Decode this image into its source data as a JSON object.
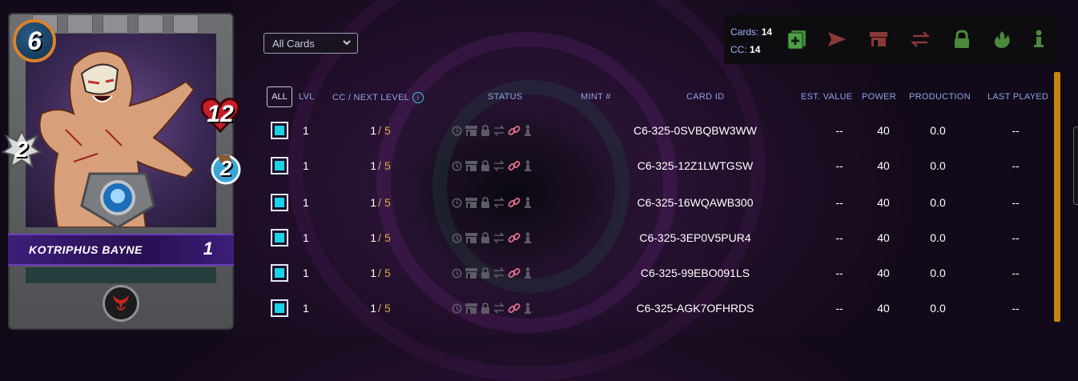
{
  "card": {
    "name": "KOTRIPHUS BAYNE",
    "level": "1",
    "mana": "6",
    "health": "12",
    "melee": "2",
    "speed": "2",
    "colors": {
      "banner": "#3c1e7a",
      "mana_ring": "#d9822b"
    },
    "icons": {
      "ability": "demon-horns-icon",
      "melee": "sawblade-icon",
      "speed": "boot-icon",
      "health": "heart-icon"
    }
  },
  "filter": {
    "selected": "All Cards"
  },
  "toolbar": {
    "cards_label": "Cards:",
    "cards_count": "14",
    "cc_label": "CC:",
    "cc_count": "14",
    "icons": [
      "add-card-icon",
      "send-icon",
      "market-icon",
      "transfer-icon",
      "lock-icon",
      "burn-icon",
      "delegate-icon"
    ]
  },
  "table": {
    "all_label": "ALL",
    "columns": {
      "lvl": "LVL",
      "cc_next": "CC / NEXT LEVEL",
      "status": "STATUS",
      "mint": "MINT #",
      "card_id": "CARD ID",
      "est_value": "EST. VALUE",
      "power": "POWER",
      "production": "PRODUCTION",
      "last_played": "LAST PLAYED"
    },
    "rows": [
      {
        "lvl": "1",
        "cc": "1",
        "next": "5",
        "card_id": "C6-325-0SVBQBW3WW",
        "est_value": "--",
        "power": "40",
        "production": "0.0",
        "last_played": "--"
      },
      {
        "lvl": "1",
        "cc": "1",
        "next": "5",
        "card_id": "C6-325-12Z1LWTGSW",
        "est_value": "--",
        "power": "40",
        "production": "0.0",
        "last_played": "--"
      },
      {
        "lvl": "1",
        "cc": "1",
        "next": "5",
        "card_id": "C6-325-16WQAWB300",
        "est_value": "--",
        "power": "40",
        "production": "0.0",
        "last_played": "--"
      },
      {
        "lvl": "1",
        "cc": "1",
        "next": "5",
        "card_id": "C6-325-3EP0V5PUR4",
        "est_value": "--",
        "power": "40",
        "production": "0.0",
        "last_played": "--"
      },
      {
        "lvl": "1",
        "cc": "1",
        "next": "5",
        "card_id": "C6-325-99EBO091LS",
        "est_value": "--",
        "power": "40",
        "production": "0.0",
        "last_played": "--"
      },
      {
        "lvl": "1",
        "cc": "1",
        "next": "5",
        "card_id": "C6-325-AGK7OFHRDS",
        "est_value": "--",
        "power": "40",
        "production": "0.0",
        "last_played": "--"
      }
    ],
    "status_icons": [
      "clock-icon",
      "market-icon",
      "lock-icon",
      "transfer-icon",
      "link-icon",
      "delegate-icon"
    ],
    "colors": {
      "checkbox": "#19d4e7",
      "header": "#8fa2e8",
      "accent": "#e0a84a",
      "link": "#e0708a"
    }
  }
}
